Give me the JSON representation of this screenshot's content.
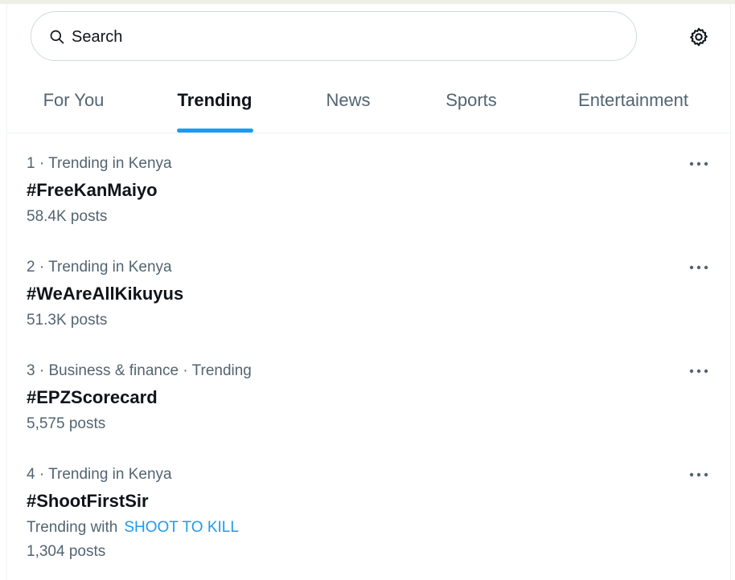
{
  "search": {
    "placeholder": "Search",
    "value": ""
  },
  "icons": {
    "search": "search-icon",
    "settings": "gear-icon",
    "more": "more-horizontal-icon"
  },
  "colors": {
    "accent": "#1d9bf0",
    "text_primary": "#0f1419",
    "text_secondary": "#536471",
    "border": "#cfd9de"
  },
  "tabs": [
    {
      "label": "For You",
      "active": false
    },
    {
      "label": "Trending",
      "active": true
    },
    {
      "label": "News",
      "active": false
    },
    {
      "label": "Sports",
      "active": false
    },
    {
      "label": "Entertainment",
      "active": false
    }
  ],
  "trends": [
    {
      "rank": "1",
      "context": "1 · Trending in Kenya",
      "name": "#FreeKanMaiyo",
      "posts": "58.4K posts"
    },
    {
      "rank": "2",
      "context": "2 · Trending in Kenya",
      "name": "#WeAreAllKikuyus",
      "posts": "51.3K posts"
    },
    {
      "rank": "3",
      "context": "3 · Business & finance · Trending",
      "name": "#EPZScorecard",
      "posts": "5,575 posts"
    },
    {
      "rank": "4",
      "context": "4 · Trending in Kenya",
      "name": "#ShootFirstSir",
      "trending_with_label": "Trending with",
      "trending_with_link": "SHOOT TO KILL",
      "posts": "1,304 posts"
    }
  ]
}
